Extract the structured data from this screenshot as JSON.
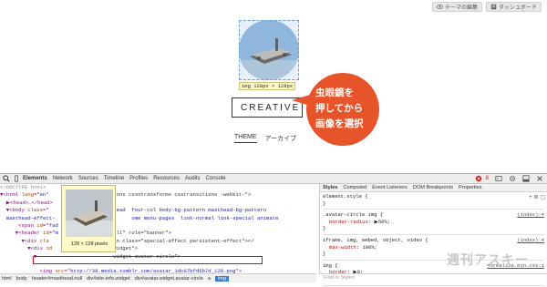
{
  "top_buttons": [
    {
      "icon": "eye-icon",
      "label": "テーマの編集"
    },
    {
      "icon": "dashboard-icon",
      "label": "ダッシュボード"
    }
  ],
  "page": {
    "img_tooltip": "img 128px × 128px",
    "blog_title": "CREATIVE",
    "nav": [
      "THEME",
      "アーカイブ"
    ]
  },
  "callout": {
    "lines": [
      "虫眼鏡を",
      "押してから",
      "画像を選択"
    ],
    "color": "#e8542a"
  },
  "devtools": {
    "tabs": [
      "Elements",
      "Network",
      "Sources",
      "Timeline",
      "Profiles",
      "Resources",
      "Audits",
      "Console"
    ],
    "active_tab": "Elements",
    "error_count": "8",
    "code_lines": [
      {
        "parts": [
          {
            "c": "c-doctype",
            "t": "<!DOCTYPE html>"
          }
        ]
      },
      {
        "parts": [
          {
            "c": "c-tag",
            "t": "▼<html "
          },
          {
            "c": "c-attr",
            "t": "lang"
          },
          {
            "c": "c-tag",
            "t": "=\""
          },
          {
            "c": "c-val",
            "t": "en"
          },
          {
            "c": "c-tag",
            "t": "\" "
          },
          {
            "c": "c-text",
            "t": "                  ations cssntransforms csstransitions -webkit-\">"
          }
        ]
      },
      {
        "parts": [
          {
            "c": "c-tag",
            "t": "  ▶<head>…</head>"
          }
        ]
      },
      {
        "parts": [
          {
            "c": "c-tag",
            "t": "  ▼<body "
          },
          {
            "c": "c-attr",
            "t": "class"
          },
          {
            "c": "c-tag",
            "t": "=\""
          },
          {
            "c": "c-val",
            "t": "                     lead  four-col body-bg-pattern masthead-bg-pattern"
          }
        ]
      },
      {
        "parts": [
          {
            "c": "c-val",
            "t": "  masthead-effect-                         ome menu-pages  link-normal link-special animate  "
          }
        ]
      },
      {
        "parts": [
          {
            "c": "c-tag",
            "t": "      <span "
          },
          {
            "c": "c-attr",
            "t": "id"
          },
          {
            "c": "c-tag",
            "t": "=\""
          },
          {
            "c": "c-val",
            "t": "fad"
          }
        ]
      },
      {
        "parts": [
          {
            "c": "c-tag",
            "t": "     ▼<header "
          },
          {
            "c": "c-attr",
            "t": "id"
          },
          {
            "c": "c-tag",
            "t": "=\""
          },
          {
            "c": "c-val",
            "t": "m"
          },
          {
            "c": "c-text",
            "t": "                   ll\" role=\"banner\">"
          }
        ]
      },
      {
        "parts": [
          {
            "c": "c-tag",
            "t": "       ▼<div "
          },
          {
            "c": "c-attr",
            "t": "cla"
          },
          {
            "c": "c-text",
            "t": "                   span class=\"special-effect persistent-effect\"></"
          }
        ]
      },
      {
        "parts": [
          {
            "c": "c-tag",
            "t": "         ▼<div "
          },
          {
            "c": "c-attr",
            "t": "id"
          },
          {
            "c": "c-text",
            "t": "                   ,widget\">"
          }
        ]
      },
      {
        "parts": [
          {
            "c": "c-tag",
            "t": "           ▼"
          },
          {
            "c": "c-text",
            "t": "                         widget avatar-circle\">"
          }
        ]
      },
      {
        "parts": [
          {
            "c": "c-tag",
            "t": "               "
          }
        ]
      },
      {
        "parts": [
          {
            "c": "c-tag",
            "t": "             <img "
          },
          {
            "c": "c-attr",
            "t": "src"
          },
          {
            "c": "c-tag",
            "t": "=\""
          },
          {
            "c": "c-link",
            "t": "http://38.media.tumblr.com/avatar_1dc07bfd6b7d_128.png"
          },
          {
            "c": "c-tag",
            "t": "\">"
          }
        ]
      },
      {
        "parts": [
          {
            "c": "c-tag",
            "t": "           </div>"
          }
        ]
      }
    ],
    "hover_preview_label": "128 × 128 pixels",
    "breadcrumbs": [
      "html",
      "body",
      "header#masthead.null",
      "div#site-info.widget",
      "div#avatar.widget.avatar-circle",
      "a"
    ],
    "breadcrumb_selected": "img",
    "styles_tabs": [
      "Styles",
      "Computed",
      "Event Listeners",
      "DOM Breakpoints",
      "Properties"
    ],
    "styles_active": "Styles",
    "rules": [
      {
        "selector": "element.style {",
        "src": "",
        "props": [],
        "close": "}"
      },
      {
        "selector": ".avatar-circle img {",
        "src": "(index):4",
        "props": [
          {
            "p": "border-radius",
            "v": "▶50%;"
          }
        ],
        "close": "}"
      },
      {
        "selector": "iframe, img, embed, object, video {",
        "src": "(index):4",
        "props": [
          {
            "p": "max-width",
            "v": "100%;"
          }
        ],
        "close": "}"
      },
      {
        "selector": "img {",
        "src": "normalize.min.css:1",
        "props": [
          {
            "p": "border",
            "v": "▶0;"
          }
        ],
        "close": "}"
      }
    ],
    "find_in_styles": "Find in Styles",
    "watermark": "週刊アスキー"
  }
}
